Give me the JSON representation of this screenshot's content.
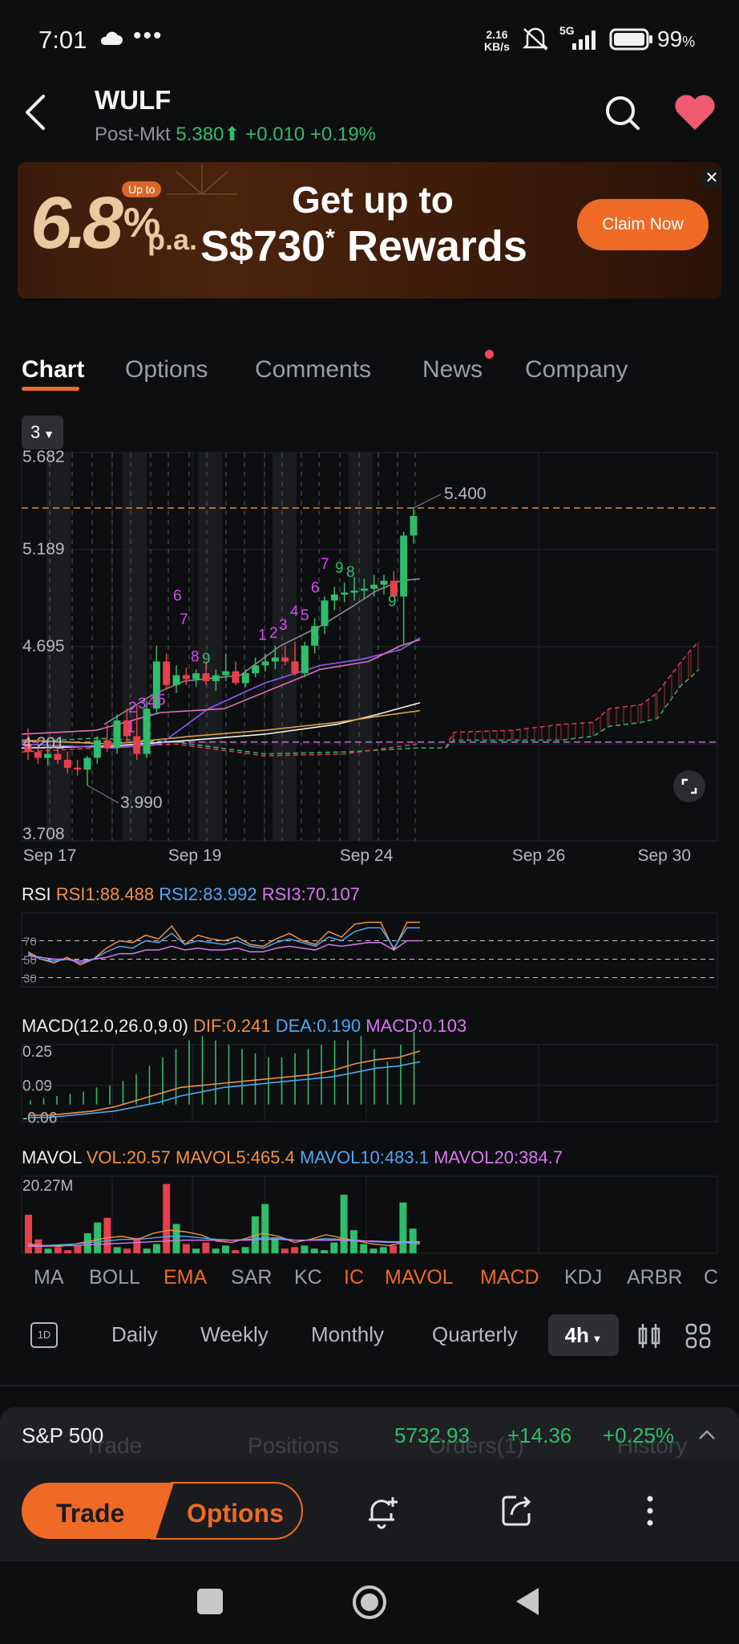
{
  "status": {
    "time": "7:01",
    "dots": "•••",
    "net_speed_value": "2.16",
    "net_speed_unit": "KB/s",
    "network": "5G",
    "battery": "99",
    "battery_unit": "%"
  },
  "header": {
    "ticker": "WULF",
    "session": "Post-Mkt",
    "price": "5.380",
    "arrow": "⬆",
    "change": "+0.010",
    "change_pct": "+0.19%"
  },
  "banner": {
    "rate": "6.8",
    "percent": "%",
    "upto_badge": "Up to",
    "pa": "p.a.",
    "title_line1": "Get up to",
    "title_line2": "S$730",
    "asterisk": "*",
    "title_line2b": " Rewards",
    "cta": "Claim Now",
    "close": "✕"
  },
  "tabs": [
    "Chart",
    "Options",
    "Comments",
    "News",
    "Company"
  ],
  "period_selector": "3",
  "chart_data": {
    "type": "candlestick",
    "y_ticks": [
      "5.682",
      "5.189",
      "4.695",
      "4.201",
      "3.708"
    ],
    "x_ticks": [
      "Sep 17",
      "Sep 19",
      "Sep 24",
      "Sep 26",
      "Sep 30"
    ],
    "ylim": [
      3.708,
      5.682
    ],
    "last_price_label": "5.400",
    "low_label": "3.990",
    "td_counts_magenta": [
      "1",
      "2",
      "3",
      "4",
      "5",
      "6",
      "7",
      "8",
      "1",
      "2",
      "3",
      "4",
      "5",
      "6",
      "7"
    ],
    "td_counts_green": [
      "9",
      "9",
      "8",
      "9"
    ],
    "candles": [
      {
        "o": 4.2,
        "h": 4.28,
        "l": 4.12,
        "c": 4.16
      },
      {
        "o": 4.16,
        "h": 4.22,
        "l": 4.1,
        "c": 4.13
      },
      {
        "o": 4.13,
        "h": 4.19,
        "l": 4.09,
        "c": 4.15
      },
      {
        "o": 4.15,
        "h": 4.2,
        "l": 4.1,
        "c": 4.12
      },
      {
        "o": 4.12,
        "h": 4.16,
        "l": 4.05,
        "c": 4.08
      },
      {
        "o": 4.08,
        "h": 4.12,
        "l": 4.04,
        "c": 4.07
      },
      {
        "o": 4.07,
        "h": 4.14,
        "l": 3.99,
        "c": 4.13
      },
      {
        "o": 4.13,
        "h": 4.24,
        "l": 4.1,
        "c": 4.22
      },
      {
        "o": 4.22,
        "h": 4.3,
        "l": 4.16,
        "c": 4.18
      },
      {
        "o": 4.18,
        "h": 4.35,
        "l": 4.15,
        "c": 4.32
      },
      {
        "o": 4.32,
        "h": 4.38,
        "l": 4.2,
        "c": 4.24
      },
      {
        "o": 4.24,
        "h": 4.4,
        "l": 4.12,
        "c": 4.15
      },
      {
        "o": 4.15,
        "h": 4.42,
        "l": 4.13,
        "c": 4.38
      },
      {
        "o": 4.38,
        "h": 4.7,
        "l": 4.35,
        "c": 4.62
      },
      {
        "o": 4.62,
        "h": 4.66,
        "l": 4.48,
        "c": 4.5
      },
      {
        "o": 4.5,
        "h": 4.6,
        "l": 4.46,
        "c": 4.55
      },
      {
        "o": 4.55,
        "h": 4.59,
        "l": 4.5,
        "c": 4.53
      },
      {
        "o": 4.53,
        "h": 4.58,
        "l": 4.49,
        "c": 4.56
      },
      {
        "o": 4.56,
        "h": 4.62,
        "l": 4.5,
        "c": 4.52
      },
      {
        "o": 4.52,
        "h": 4.58,
        "l": 4.47,
        "c": 4.55
      },
      {
        "o": 4.55,
        "h": 4.66,
        "l": 4.52,
        "c": 4.57
      },
      {
        "o": 4.57,
        "h": 4.62,
        "l": 4.5,
        "c": 4.51
      },
      {
        "o": 4.51,
        "h": 4.58,
        "l": 4.49,
        "c": 4.56
      },
      {
        "o": 4.56,
        "h": 4.64,
        "l": 4.54,
        "c": 4.6
      },
      {
        "o": 4.6,
        "h": 4.66,
        "l": 4.57,
        "c": 4.62
      },
      {
        "o": 4.62,
        "h": 4.7,
        "l": 4.58,
        "c": 4.64
      },
      {
        "o": 4.64,
        "h": 4.7,
        "l": 4.6,
        "c": 4.62
      },
      {
        "o": 4.62,
        "h": 4.72,
        "l": 4.55,
        "c": 4.56
      },
      {
        "o": 4.56,
        "h": 4.72,
        "l": 4.54,
        "c": 4.7
      },
      {
        "o": 4.7,
        "h": 4.84,
        "l": 4.66,
        "c": 4.8
      },
      {
        "o": 4.8,
        "h": 4.95,
        "l": 4.76,
        "c": 4.93
      },
      {
        "o": 4.93,
        "h": 5.0,
        "l": 4.88,
        "c": 4.96
      },
      {
        "o": 4.96,
        "h": 5.02,
        "l": 4.92,
        "c": 4.97
      },
      {
        "o": 4.97,
        "h": 5.05,
        "l": 4.93,
        "c": 4.98
      },
      {
        "o": 4.98,
        "h": 5.04,
        "l": 4.94,
        "c": 4.99
      },
      {
        "o": 4.99,
        "h": 5.06,
        "l": 4.95,
        "c": 5.01
      },
      {
        "o": 5.01,
        "h": 5.06,
        "l": 4.96,
        "c": 5.03
      },
      {
        "o": 5.03,
        "h": 5.08,
        "l": 4.98,
        "c": 4.95
      },
      {
        "o": 4.95,
        "h": 5.28,
        "l": 4.7,
        "c": 5.26
      },
      {
        "o": 5.26,
        "h": 5.4,
        "l": 5.22,
        "c": 5.36
      }
    ]
  },
  "rsi": {
    "label": "RSI",
    "rsi1": "RSI1:88.488",
    "rsi2": "RSI2:83.992",
    "rsi3": "RSI3:70.107",
    "levels": [
      "70",
      "50",
      "30"
    ]
  },
  "macd": {
    "label": "MACD(12.0,26.0,9.0)",
    "dif": "DIF:0.241",
    "dea": "DEA:0.190",
    "macd": "MACD:0.103",
    "ticks": [
      "0.25",
      "0.09",
      "-0.06"
    ]
  },
  "mavol": {
    "label": "MAVOL",
    "vol": "VOL:20.57",
    "mavol5": "MAVOL5:465.4",
    "mavol10": "MAVOL10:483.1",
    "mavol20": "MAVOL20:384.7",
    "max_tick": "20.27M"
  },
  "indicators": [
    "MA",
    "BOLL",
    "EMA",
    "SAR",
    "KC",
    "IC",
    "MAVOL",
    "MACD",
    "KDJ",
    "ARBR",
    "C"
  ],
  "periods": {
    "oneday_icon": "1D",
    "items": [
      "Daily",
      "Weekly",
      "Monthly",
      "Quarterly"
    ],
    "selected": "4h"
  },
  "index_bar": {
    "name": "S&P 500",
    "value": "5732.93",
    "change": "+14.36",
    "change_pct": "+0.25%",
    "ghost_tabs": [
      "Trade",
      "Positions",
      "Orders(1)",
      "History"
    ]
  },
  "actions": {
    "trade": "Trade",
    "options": "Options"
  },
  "colors": {
    "accent": "#ee6a25",
    "up": "#2fbd6b",
    "down": "#e5404b",
    "bg": "#0d0e10"
  }
}
